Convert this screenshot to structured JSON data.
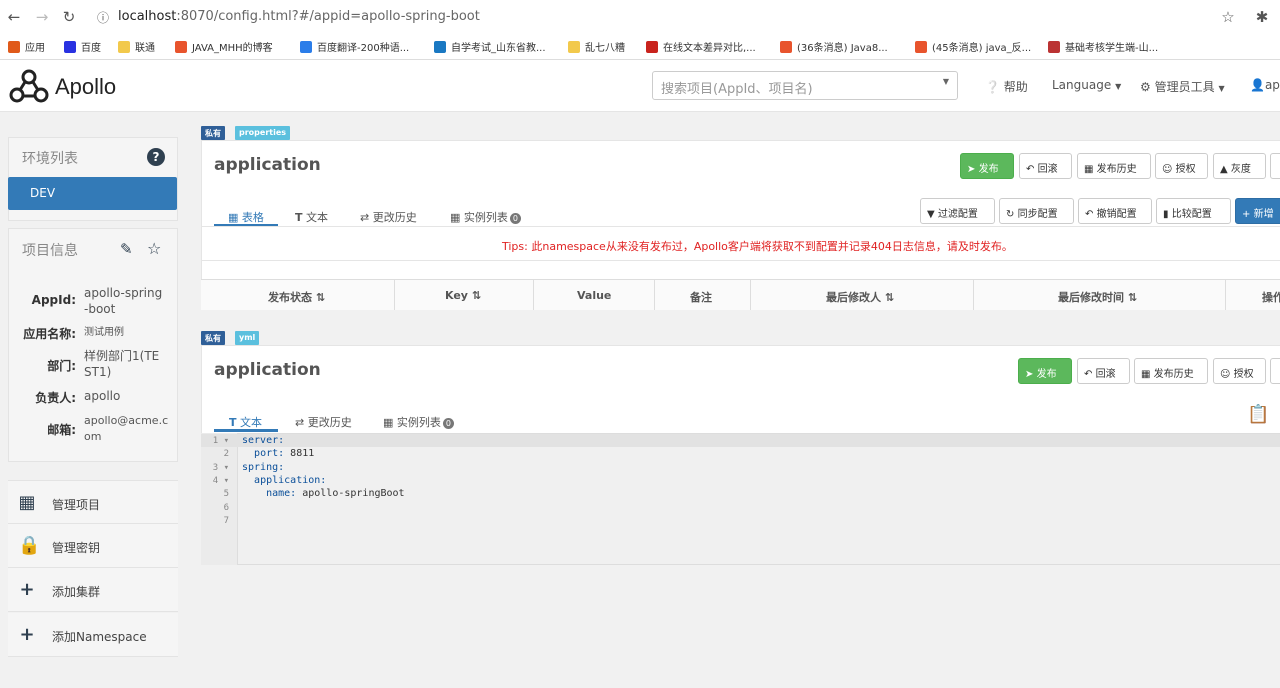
{
  "browser": {
    "url_host": "localhost",
    "url_path": ":8070/config.html?#/appid=apollo-spring-boot",
    "bookmarks": [
      {
        "label": "应用",
        "color": "#e05a1a"
      },
      {
        "label": "百度",
        "color": "#2932e1"
      },
      {
        "label": "联通",
        "color": "#f2c94c"
      },
      {
        "label": "JAVA_MHH的博客",
        "color": "#e8542d"
      },
      {
        "label": "百度翻译-200种语...",
        "color": "#2b7de9"
      },
      {
        "label": "自学考试_山东省教...",
        "color": "#1a78c2"
      },
      {
        "label": "乱七八糟",
        "color": "#f2c94c"
      },
      {
        "label": "在线文本差异对比,...",
        "color": "#c9231d"
      },
      {
        "label": "(36条消息) Java8...",
        "color": "#e8542d"
      },
      {
        "label": "(45条消息) java_反...",
        "color": "#e8542d"
      },
      {
        "label": "基础考核学生端-山...",
        "color": "#b33"
      }
    ]
  },
  "header": {
    "logo": "Apollo",
    "search_placeholder": "搜索项目(AppId、项目名)",
    "help": "帮助",
    "language": "Language",
    "admin_tools": "管理员工具",
    "user": "apo"
  },
  "sidebar": {
    "env_title": "环境列表",
    "env_items": [
      "DEV"
    ],
    "project_title": "项目信息",
    "project_info": [
      {
        "label": "AppId:",
        "value": "apollo-spring\n-boot"
      },
      {
        "label": "应用名称:",
        "value": "测试用例"
      },
      {
        "label": "部门:",
        "value": "样例部门1(TE\nST1)"
      },
      {
        "label": "负责人:",
        "value": "apollo"
      },
      {
        "label": "邮箱:",
        "value": "apollo@acme.c\nom"
      }
    ],
    "actions": [
      "管理项目",
      "管理密钥",
      "添加集群",
      "添加Namespace"
    ]
  },
  "namespace1": {
    "tag_private": "私有",
    "tag_format": "properties",
    "title": "application",
    "buttons": [
      "发布",
      "回滚",
      "发布历史",
      "授权",
      "灰度"
    ],
    "tabs": [
      "表格",
      "文本",
      "更改历史",
      "实例列表"
    ],
    "instance_count": "0",
    "tools": [
      "过滤配置",
      "同步配置",
      "撤销配置",
      "比较配置",
      "新增"
    ],
    "tips": "Tips: 此namespace从来没有发布过，Apollo客户端将获取不到配置并记录404日志信息，请及时发布。",
    "columns": [
      "发布状态",
      "Key",
      "Value",
      "备注",
      "最后修改人",
      "最后修改时间",
      "操作"
    ]
  },
  "namespace2": {
    "tag_private": "私有",
    "tag_format": "yml",
    "title": "application",
    "buttons": [
      "发布",
      "回滚",
      "发布历史",
      "授权"
    ],
    "tabs": [
      "文本",
      "更改历史",
      "实例列表"
    ],
    "instance_count": "0",
    "code_lines": [
      {
        "num": "1",
        "text": "server:"
      },
      {
        "num": "2",
        "text": "  port: 8811"
      },
      {
        "num": "3",
        "text": "spring:"
      },
      {
        "num": "4",
        "text": "  application:"
      },
      {
        "num": "5",
        "text": "    name: apollo-springBoot"
      },
      {
        "num": "6",
        "text": ""
      },
      {
        "num": "7",
        "text": ""
      }
    ]
  },
  "colors": {
    "primary": "#337ab7",
    "success": "#5cb85c",
    "tag_private": "#2f5f98",
    "tag_format": "#5bc0de",
    "tips": "#e02222"
  }
}
